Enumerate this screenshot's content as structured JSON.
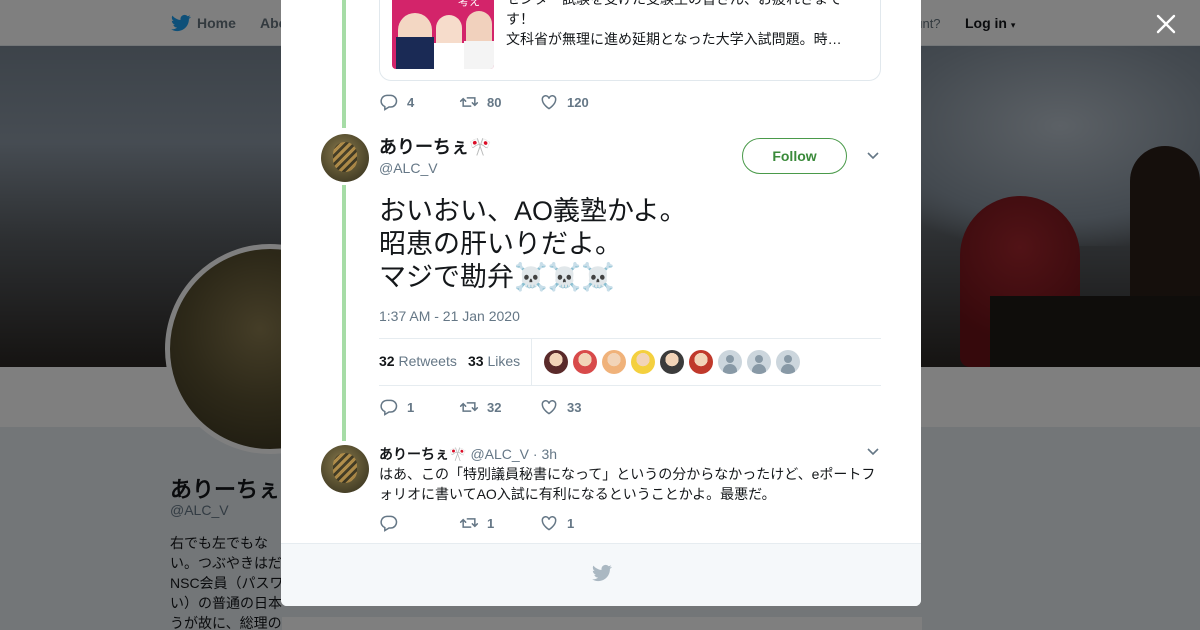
{
  "background_page": {
    "nav": {
      "home": "Home",
      "about": "Abo",
      "have_account": "ccount?",
      "login": "Log in"
    },
    "profile": {
      "name": "ありーちぇ",
      "handle": "@ALC_V",
      "bio": "右でも左でもない。つぶやきはだNSC会員（パスワい）の普通の日本うが故に、総理の"
    },
    "colors": {
      "twitter_blue": "#1da1f2",
      "thread_green": "#a6dca6",
      "follow_green": "#3a8a3a"
    }
  },
  "modal": {
    "quoted_tweet": {
      "text_line1": "センター試験を受けた受験生の皆さん、お疲れさまです！",
      "text_line2": "文科省が無理に進め延期となった大学入試問題。時…",
      "image_caption": "考え"
    },
    "quoted_actions": {
      "replies": "4",
      "retweets": "80",
      "likes": "120"
    },
    "main_tweet": {
      "author_name": "ありーちぇ🎌",
      "author_handle": "@ALC_V",
      "follow_label": "Follow",
      "body_lines": [
        "おいおい、AO義塾かよ。",
        "昭恵の肝いりだよ。",
        "マジで勘弁☠️☠️☠️"
      ],
      "timestamp": "1:37 AM - 21 Jan 2020",
      "retweet_count": "32",
      "retweet_label": "Retweets",
      "like_count": "33",
      "like_label": "Likes",
      "likers": [
        {
          "color": "#5a2a2a"
        },
        {
          "color": "#d84a4a"
        },
        {
          "color": "#f0b27a"
        },
        {
          "color": "#f4d03f"
        },
        {
          "color": "#3b3b3b"
        },
        {
          "color": "#c0392b"
        },
        {
          "color": "default"
        },
        {
          "color": "default"
        },
        {
          "color": "default"
        }
      ]
    },
    "main_actions": {
      "replies": "1",
      "retweets": "32",
      "likes": "33"
    },
    "reply_tweet": {
      "author_name": "ありーちぇ🎌",
      "author_handle": "@ALC_V",
      "time": "· 3h",
      "text": "はあ、この「特別議員秘書になって」というの分からなかったけど、eポートフォリオに書いてAO入試に有利になるということかよ。最悪だ。"
    },
    "reply_actions": {
      "replies": "",
      "retweets": "1",
      "likes": "1"
    }
  }
}
